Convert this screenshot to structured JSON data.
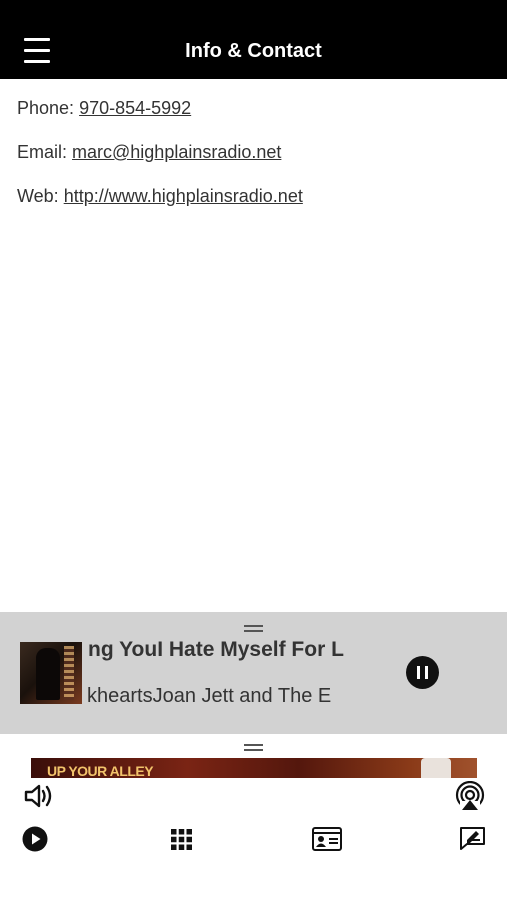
{
  "header": {
    "title": "Info & Contact",
    "menu_icon": "hamburger-menu-icon"
  },
  "contact": {
    "phone_label": "Phone: ",
    "phone_value": "970-854-5992",
    "email_label": "Email: ",
    "email_value": "marc@highplainsradio.net",
    "web_label": "Web: ",
    "web_value": "http://www.highplainsradio.net"
  },
  "now_playing": {
    "title": "ng YouI Hate Myself For L",
    "artist": "kheartsJoan Jett and The E",
    "album_art_text": "UP YOUR ALLEY",
    "pause_icon": "pause-icon"
  },
  "toolbar": {
    "volume_icon": "volume-icon",
    "airplay_icon": "airplay-icon",
    "play_icon": "play-icon",
    "grid_icon": "grid-icon",
    "contact_card_icon": "contact-card-icon",
    "message_edit_icon": "message-edit-icon"
  },
  "colors": {
    "header_bg": "#000000",
    "player_bg": "#d2d2d2",
    "text": "#333333"
  }
}
